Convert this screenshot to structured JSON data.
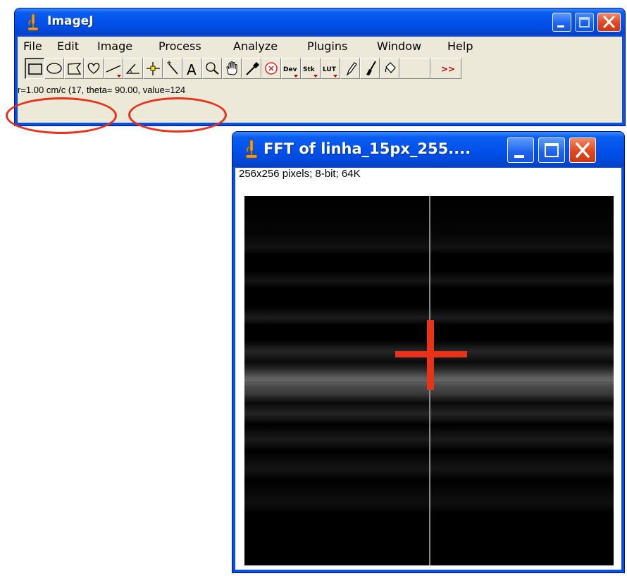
{
  "imagej": {
    "title": "ImageJ",
    "menu": [
      "File",
      "Edit",
      "Image",
      "Process",
      "Analyze",
      "Plugins",
      "Window",
      "Help"
    ],
    "toolbar": {
      "dev_label": "Dev",
      "stk_label": "Stk",
      "lut_label": "LUT",
      "more_label": ">>",
      "text_tool_label": "A"
    },
    "status": "r=1.00 cm/c (17, theta= 90.00, value=124"
  },
  "fft_window": {
    "title": "FFT of linha_15px_255....",
    "info": "256x256 pixels; 8-bit; 64K"
  },
  "colors": {
    "annotation": "#e8321a",
    "marker": "#e8321a",
    "xp_blue": "#0a4fe0"
  }
}
